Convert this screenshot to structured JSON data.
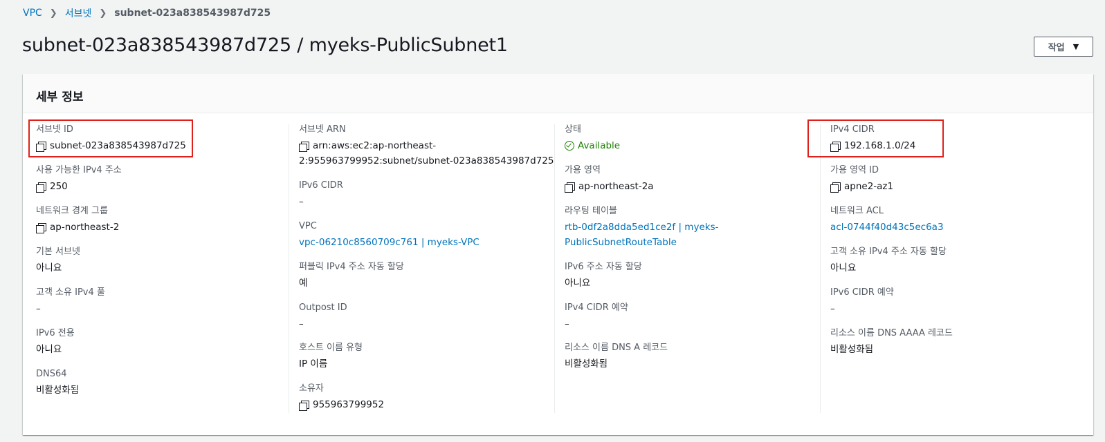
{
  "breadcrumb": {
    "vpc": "VPC",
    "subnets": "서브넷",
    "current": "subnet-023a838543987d725"
  },
  "page": {
    "title": "subnet-023a838543987d725 / myeks-PublicSubnet1",
    "actions_label": "작업"
  },
  "panel": {
    "title": "세부 정보"
  },
  "col1": {
    "subnet_id_label": "서브넷 ID",
    "subnet_id_value": "subnet-023a838543987d725",
    "avail_ipv4_label": "사용 가능한 IPv4 주소",
    "avail_ipv4_value": "250",
    "nbg_label": "네트워크 경계 그룹",
    "nbg_value": "ap-northeast-2",
    "default_subnet_label": "기본 서브넷",
    "default_subnet_value": "아니요",
    "coip_label": "고객 소유 IPv4 풀",
    "coip_value": "–",
    "ipv6_only_label": "IPv6 전용",
    "ipv6_only_value": "아니요",
    "dns64_label": "DNS64",
    "dns64_value": "비활성화됨"
  },
  "col2": {
    "arn_label": "서브넷 ARN",
    "arn_value_line1": "arn:aws:ec2:ap-northeast-",
    "arn_value_line2": "2:955963799952:subnet/subnet-023a838543987d725",
    "ipv6_cidr_label": "IPv6 CIDR",
    "ipv6_cidr_value": "–",
    "vpc_label": "VPC",
    "vpc_value": "vpc-06210c8560709c761 | myeks-VPC",
    "auto_ipv4_label": "퍼블릭 IPv4 주소 자동 할당",
    "auto_ipv4_value": "예",
    "outpost_label": "Outpost ID",
    "outpost_value": "–",
    "hostname_label": "호스트 이름 유형",
    "hostname_value": "IP 이름",
    "owner_label": "소유자",
    "owner_value": "955963799952"
  },
  "col3": {
    "state_label": "상태",
    "state_value": "Available",
    "az_label": "가용 영역",
    "az_value": "ap-northeast-2a",
    "rt_label": "라우팅 테이블",
    "rt_value_line1": "rtb-0df2a8dda5ed1ce2f | myeks-",
    "rt_value_line2": "PublicSubnetRouteTable",
    "auto_ipv6_label": "IPv6 주소 자동 할당",
    "auto_ipv6_value": "아니요",
    "ipv4_reservation_label": "IPv4 CIDR 예약",
    "ipv4_reservation_value": "–",
    "dns_a_label": "리소스 이름 DNS A 레코드",
    "dns_a_value": "비활성화됨"
  },
  "col4": {
    "ipv4_cidr_label": "IPv4 CIDR",
    "ipv4_cidr_value": "192.168.1.0/24",
    "az_id_label": "가용 영역 ID",
    "az_id_value": "apne2-az1",
    "acl_label": "네트워크 ACL",
    "acl_value": "acl-0744f40d43c5ec6a3",
    "coip_auto_label": "고객 소유 IPv4 주소 자동 할당",
    "coip_auto_value": "아니요",
    "ipv6_reservation_label": "IPv6 CIDR 예약",
    "ipv6_reservation_value": "–",
    "dns_aaaa_label": "리소스 이름 DNS AAAA 레코드",
    "dns_aaaa_value": "비활성화됨"
  },
  "colors": {
    "link": "#0073bb",
    "ok": "#1d8102",
    "highlight": "#e0211b"
  }
}
